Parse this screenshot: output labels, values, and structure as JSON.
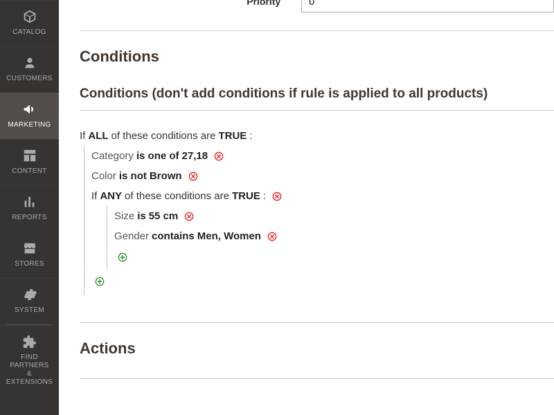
{
  "sidebar": {
    "items": [
      {
        "label": "CATALOG"
      },
      {
        "label": "CUSTOMERS"
      },
      {
        "label": "MARKETING"
      },
      {
        "label": "CONTENT"
      },
      {
        "label": "REPORTS"
      },
      {
        "label": "STORES"
      },
      {
        "label": "SYSTEM"
      },
      {
        "label": "FIND PARTNERS\n& EXTENSIONS"
      }
    ],
    "active_index": 2
  },
  "priority": {
    "label": "Priority",
    "value": "0"
  },
  "sections": {
    "conditions_title": "Conditions",
    "conditions_subtitle": "Conditions (don't add conditions if rule is applied to all products)",
    "actions_title": "Actions"
  },
  "cond": {
    "root": {
      "prefix": "If",
      "aggregator": "ALL",
      "mid": "of these conditions are",
      "value": "TRUE",
      "suffix": ":"
    },
    "lines": [
      {
        "attribute": "Category",
        "operator": "is one of",
        "value": "27,18"
      },
      {
        "attribute": "Color",
        "operator": "is not",
        "value": "Brown"
      }
    ],
    "nested": {
      "prefix": "If",
      "aggregator": "ANY",
      "mid": "of these conditions are",
      "value": "TRUE",
      "suffix": ":",
      "lines": [
        {
          "attribute": "Size",
          "operator": "is",
          "value": "55 cm"
        },
        {
          "attribute": "Gender",
          "operator": "contains",
          "value": "Men, Women"
        }
      ]
    }
  }
}
